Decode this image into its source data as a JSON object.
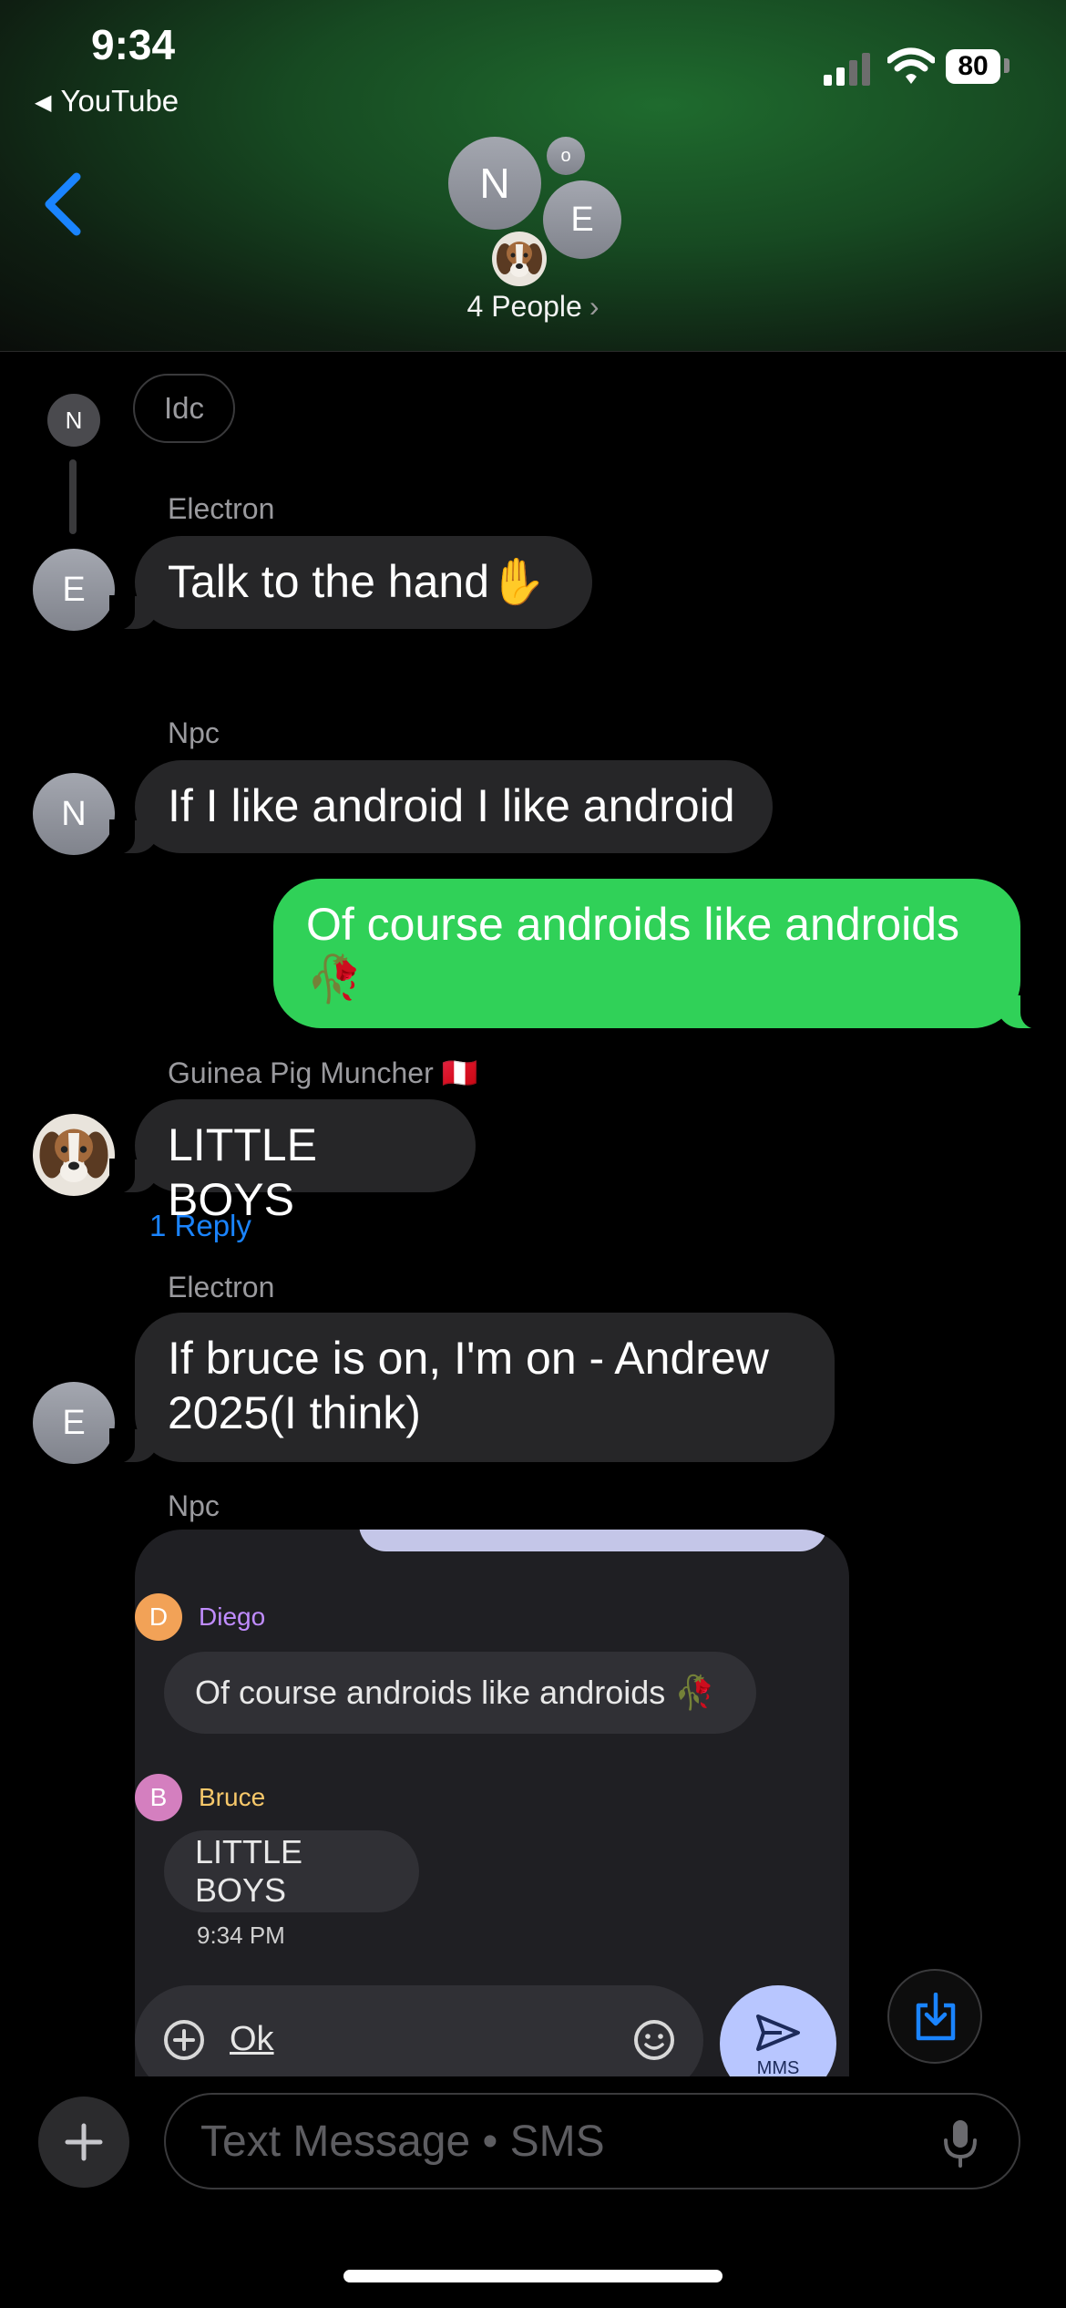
{
  "status": {
    "time": "9:34",
    "back_app": "YouTube",
    "battery": "80"
  },
  "header": {
    "avatars": [
      "N",
      "E"
    ],
    "unread_badge": "o",
    "group_label": "4 People"
  },
  "messages": {
    "m0": {
      "avatar": "N",
      "text": "Idc"
    },
    "m1": {
      "sender": "Electron",
      "avatar": "E",
      "text": "Talk to the hand✋"
    },
    "m2": {
      "sender": "Npc",
      "avatar": "N",
      "text": "If I like android I like android"
    },
    "m3": {
      "text_line1": "Of course androids like androids",
      "text_line2": "🥀"
    },
    "m4": {
      "sender": "Guinea Pig Muncher 🇵🇪",
      "text": "LITTLE BOYS",
      "replies": "1 Reply"
    },
    "m5": {
      "sender": "Electron",
      "avatar": "E",
      "text_line1": "If bruce is on, I'm on - Andrew",
      "text_line2": "2025(I think)"
    },
    "m6": {
      "sender": "Npc"
    }
  },
  "screenshot": {
    "diego": {
      "initial": "D",
      "name": "Diego",
      "text": "Of course androids like androids 🥀"
    },
    "bruce": {
      "initial": "B",
      "name": "Bruce",
      "text": "LITTLE BOYS",
      "time": "9:34 PM"
    },
    "input_value": "Ok",
    "send_label": "MMS"
  },
  "composer": {
    "placeholder": "Text Message • SMS"
  },
  "colors": {
    "accent": "#1a84ff",
    "sent_bubble": "#30d158",
    "received_bubble": "#262628",
    "diego": "#c08cff",
    "bruce": "#f7c86a"
  }
}
